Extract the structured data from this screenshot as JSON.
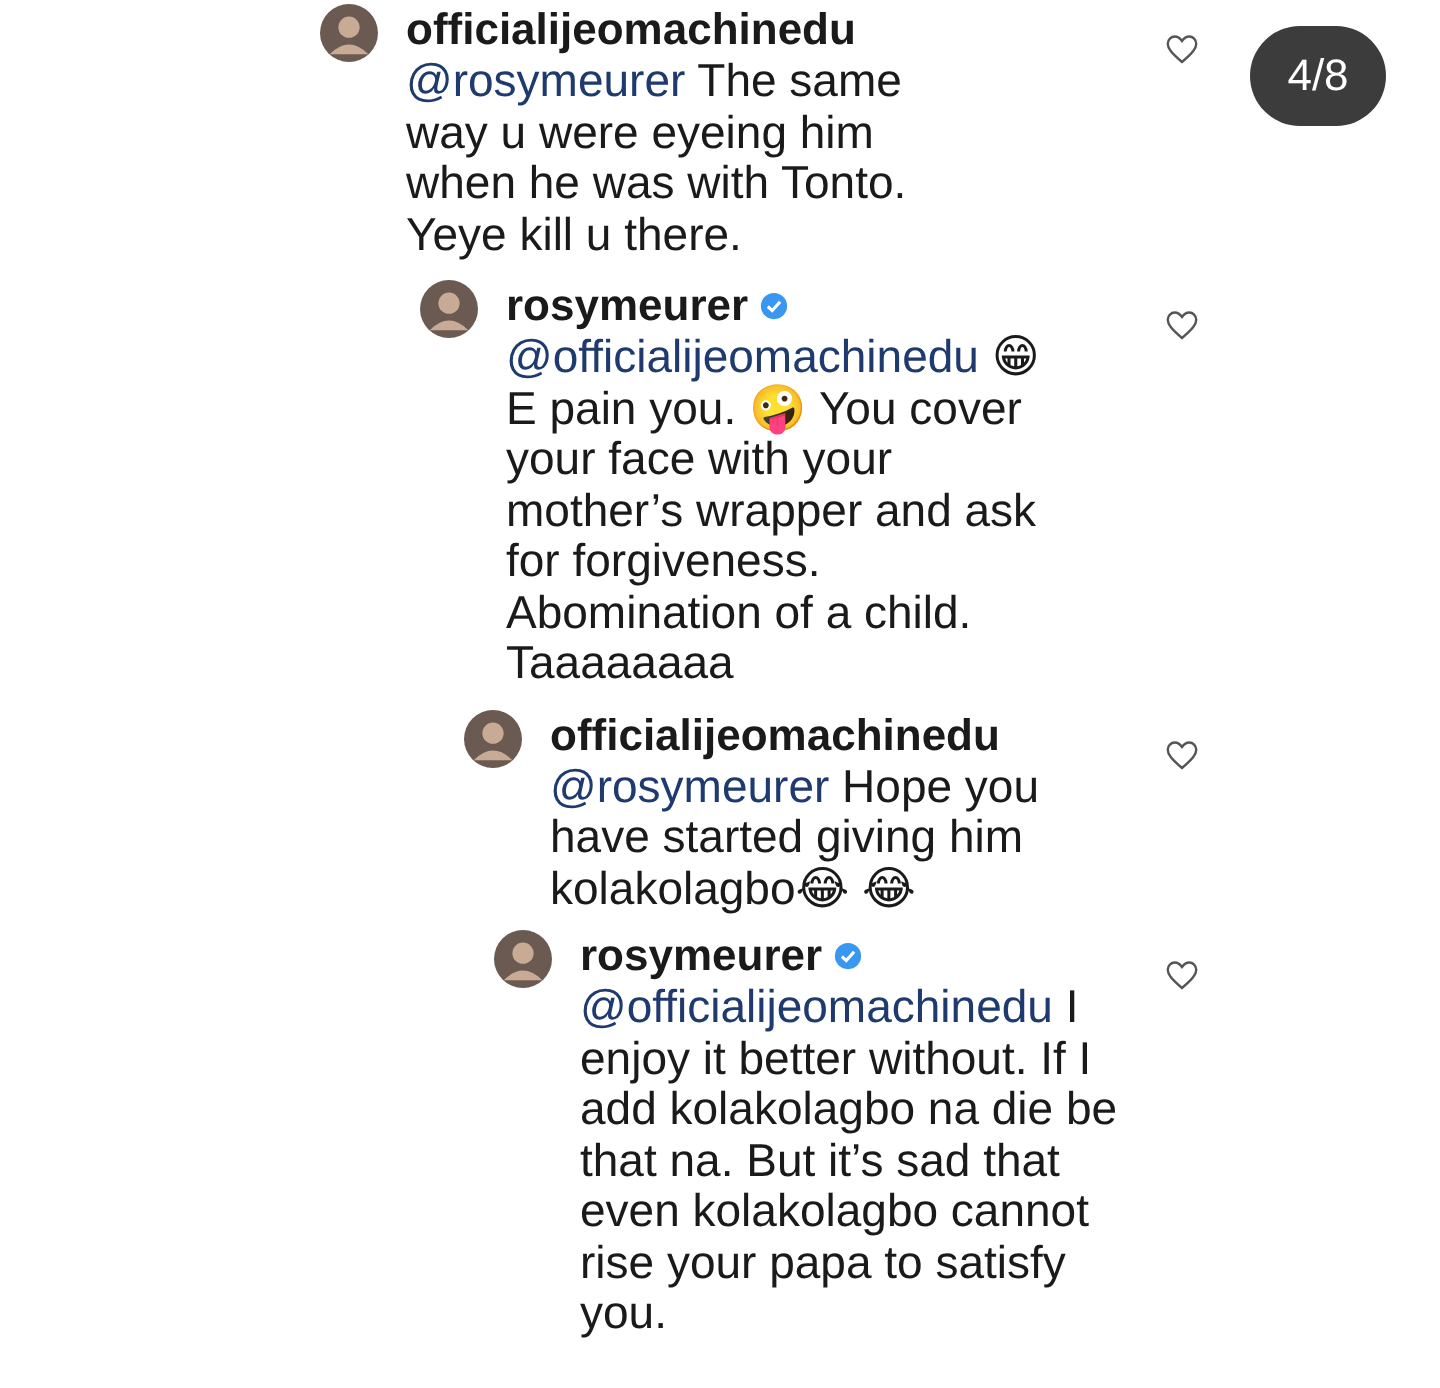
{
  "page_counter": "4/8",
  "comments": [
    {
      "username": "officialijeomachinedu",
      "verified": false,
      "liked": false,
      "mention": "@rosymeurer",
      "text": "The same way u were eyeing him when he was with Tonto. Yeye kill u there.",
      "children": [
        {
          "username": "rosymeurer",
          "verified": true,
          "liked": false,
          "mention": "@officialijeomachinedu",
          "text": "😁 E pain you. 🤪 You cover your face with your mother’s wrapper and ask for forgiveness. Abomination of a child. Taaaaaaaa",
          "children": [
            {
              "username": "officialijeomachinedu",
              "verified": false,
              "liked": false,
              "mention": "@rosymeurer",
              "text": "Hope you have started giving him kolakolagbo😂 😂",
              "children": [
                {
                  "username": "rosymeurer",
                  "verified": true,
                  "liked": false,
                  "mention": "@officialijeomachinedu",
                  "text": "I enjoy it better without. If I add kolakolagbo na die be that na. But it’s sad that even kolakolagbo cannot rise your papa to satisfy you."
                }
              ]
            }
          ]
        }
      ]
    }
  ]
}
